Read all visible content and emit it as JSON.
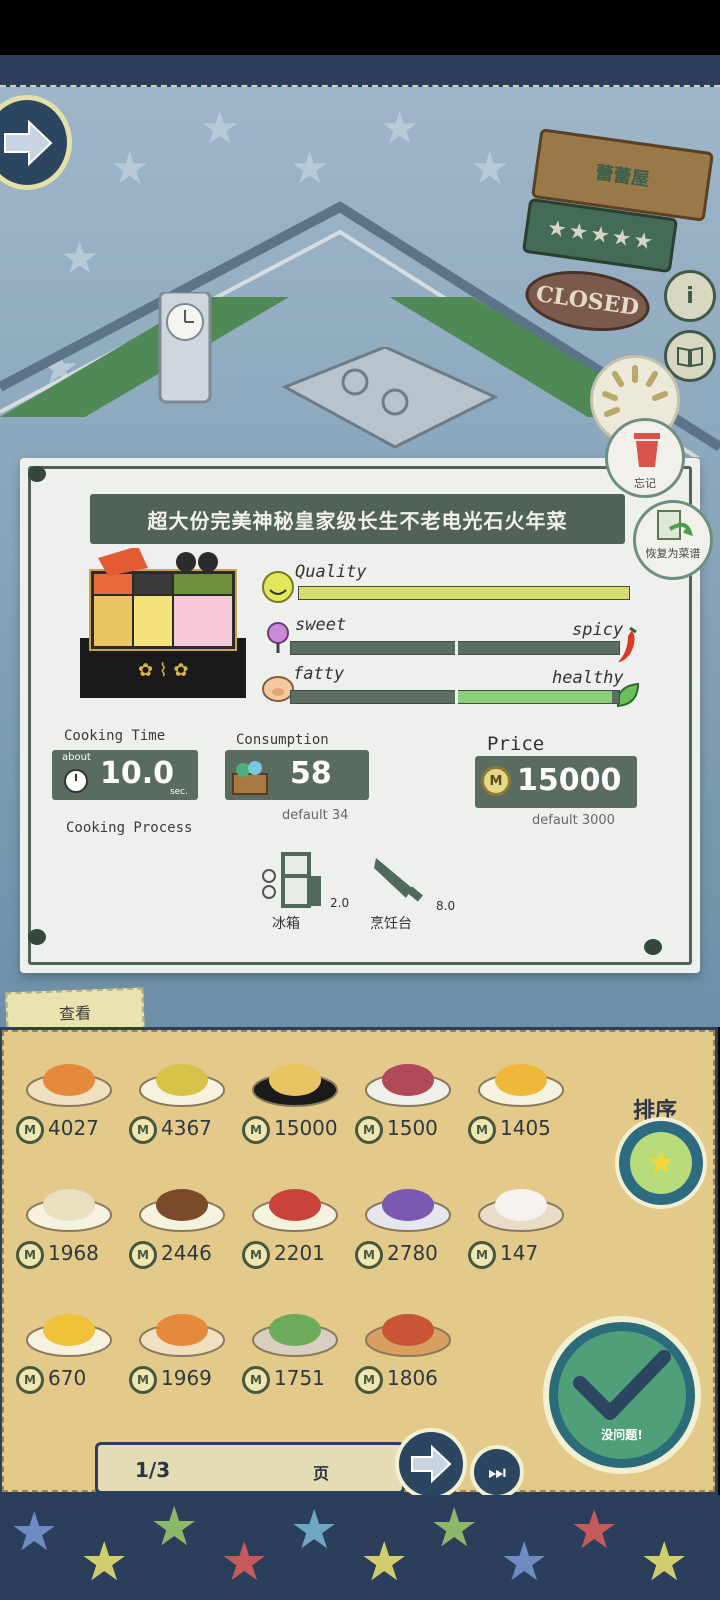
{
  "shop": {
    "sign_name": "蕾蕾屋",
    "closed_label": "CLOSED",
    "rating_stars": 5
  },
  "recipe": {
    "title": "超大份完美神秘皇家级长生不老电光石火年菜",
    "quality_label": "Quality",
    "quality_level": 1.0,
    "sweet_label": "sweet",
    "spicy_label": "spicy",
    "taste_balance": 0.5,
    "fatty_label": "fatty",
    "healthy_label": "healthy",
    "health_balance": 0.98,
    "cooking_time_label": "Cooking Time",
    "about_label": "about",
    "cooking_time_value": "10.0",
    "sec_label": "sec.",
    "consumption_label": "Consumption",
    "consumption_value": "58",
    "consumption_default": "default 34",
    "price_label": "Price",
    "price_value": "15000",
    "price_default": "default 3000",
    "cooking_process_label": "Cooking Process",
    "equipment": [
      {
        "name": "冰箱",
        "value": "2.0",
        "icon": "fridge-icon"
      },
      {
        "name": "烹饪台",
        "value": "8.0",
        "icon": "knife-icon"
      }
    ]
  },
  "actions": {
    "forget_label": "忘记",
    "restore_label": "恢复为菜谱"
  },
  "panel": {
    "view_tab": "查看",
    "sort_label": "排序",
    "confirm_label": "没问题!",
    "coin_symbol": "M",
    "items": [
      {
        "price": "4027",
        "dish": "tempura"
      },
      {
        "price": "4367",
        "dish": "quiche"
      },
      {
        "price": "15000",
        "dish": "bento-box"
      },
      {
        "price": "1500",
        "dish": "red-rice"
      },
      {
        "price": "1405",
        "dish": "omelette-rice"
      },
      {
        "price": "1968",
        "dish": "sandwich"
      },
      {
        "price": "2446",
        "dish": "hamburg-steak"
      },
      {
        "price": "2201",
        "dish": "steak-tomato"
      },
      {
        "price": "2780",
        "dish": "mixed-veg"
      },
      {
        "price": "147",
        "dish": "rice-bowl"
      },
      {
        "price": "670",
        "dish": "fried-egg"
      },
      {
        "price": "1969",
        "dish": "tempura-platter"
      },
      {
        "price": "1751",
        "dish": "mochi"
      },
      {
        "price": "1806",
        "dish": "pizza"
      }
    ],
    "page_indicator": "1/3",
    "page_unit": "页"
  },
  "colors": {
    "ribbon": "#2b3f5c",
    "card": "#eef0ee",
    "panel": "#e3c98a",
    "bar_dark": "#5c6e62",
    "bar_light": "#c9d58c",
    "healthy": "#8ccf7a"
  }
}
